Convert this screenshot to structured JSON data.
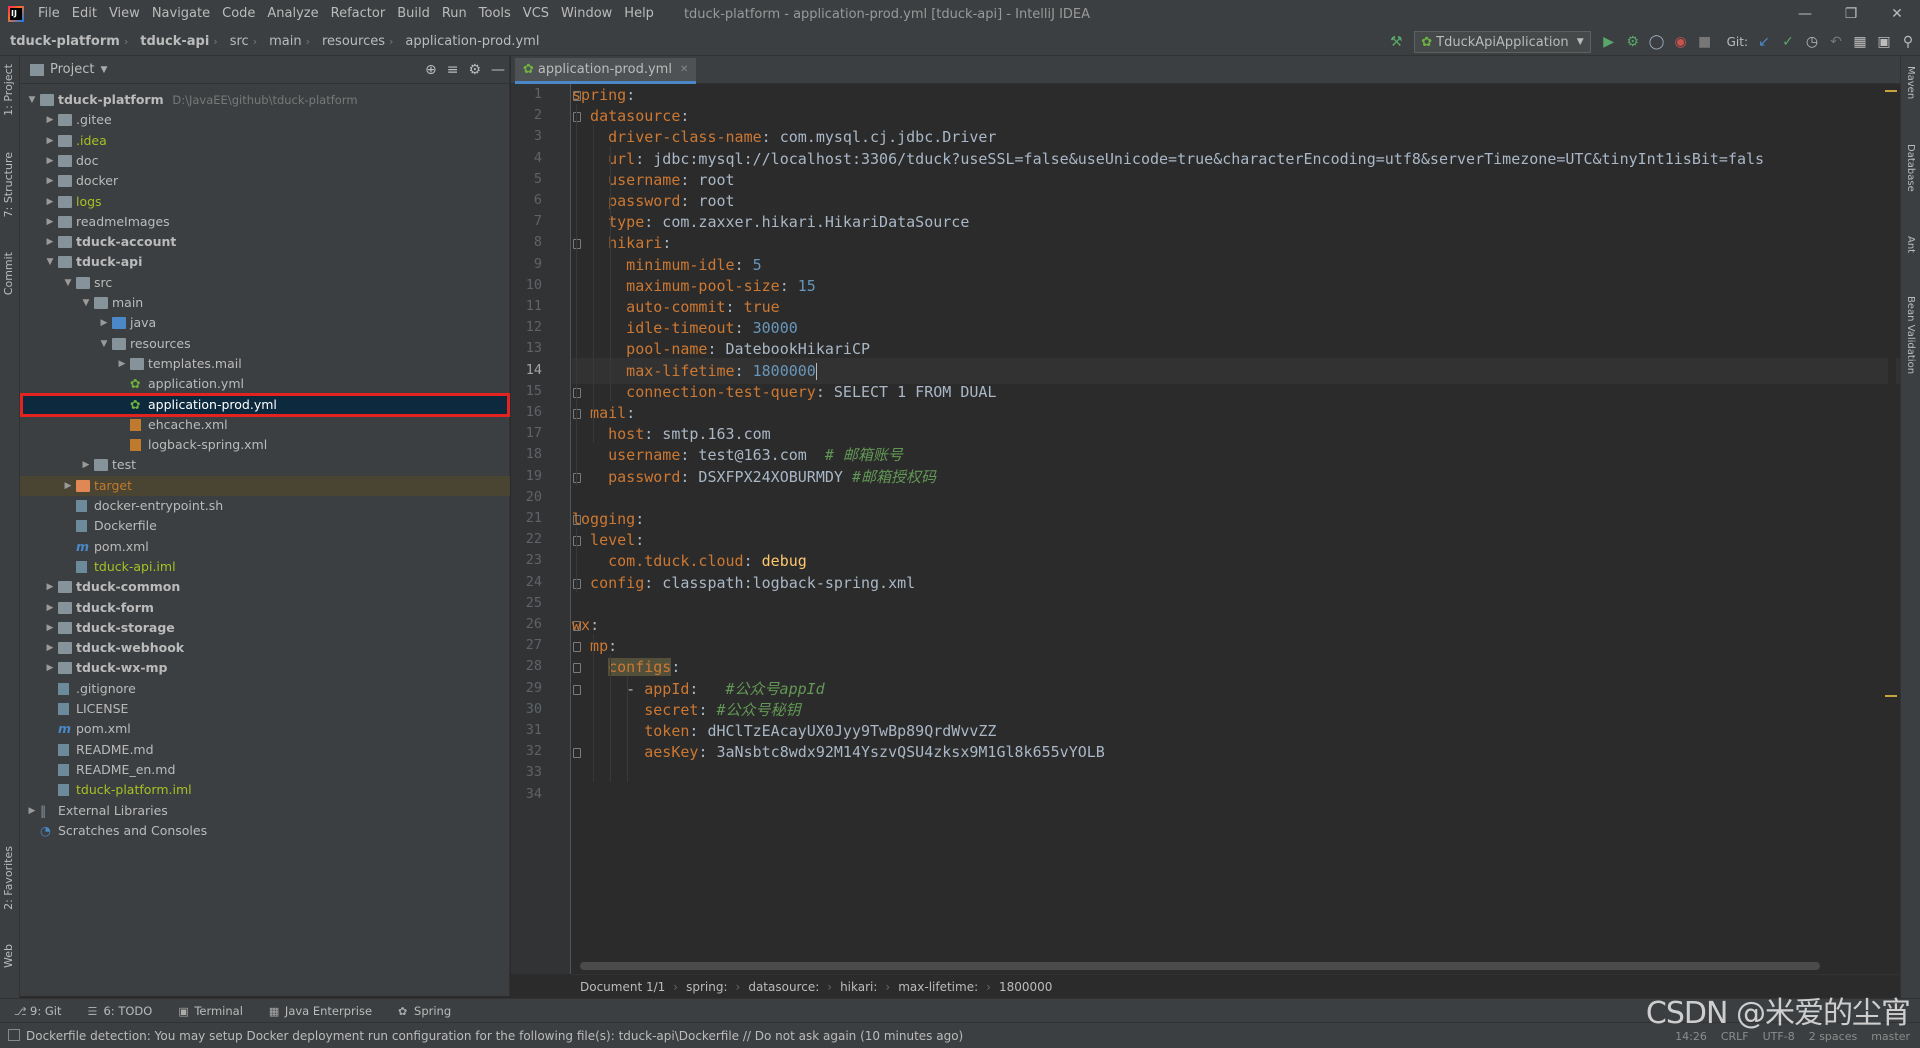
{
  "window": {
    "title": "tduck-platform - application-prod.yml [tduck-api] - IntelliJ IDEA",
    "menu": [
      "File",
      "Edit",
      "View",
      "Navigate",
      "Code",
      "Analyze",
      "Refactor",
      "Build",
      "Run",
      "Tools",
      "VCS",
      "Window",
      "Help"
    ],
    "logo_text": "IJ"
  },
  "navbar": {
    "crumbs": [
      "tduck-platform",
      "tduck-api",
      "src",
      "main",
      "resources",
      "application-prod.yml"
    ],
    "run_config": "TduckApiApplication",
    "git_label": "Git:"
  },
  "left_strip": [
    "1: Project",
    "7: Structure",
    "Commit",
    "2: Favorites",
    "Web"
  ],
  "right_strip": [
    "Maven",
    "Database",
    "Ant",
    "Bean Validation"
  ],
  "project_panel": {
    "title": "Project",
    "tree": [
      {
        "label": "tduck-platform",
        "path": "D:\\JavaEE\\github\\tduck-platform",
        "depth": 0,
        "arrow": "open",
        "icon": "folder",
        "bold": true
      },
      {
        "label": ".gitee",
        "depth": 1,
        "arrow": "closed",
        "icon": "folder"
      },
      {
        "label": ".idea",
        "depth": 1,
        "arrow": "closed",
        "icon": "folder",
        "color": "#a8c023"
      },
      {
        "label": "doc",
        "depth": 1,
        "arrow": "closed",
        "icon": "folder"
      },
      {
        "label": "docker",
        "depth": 1,
        "arrow": "closed",
        "icon": "folder"
      },
      {
        "label": "logs",
        "depth": 1,
        "arrow": "closed",
        "icon": "folder",
        "color": "#a8c023"
      },
      {
        "label": "readmeImages",
        "depth": 1,
        "arrow": "closed",
        "icon": "folder"
      },
      {
        "label": "tduck-account",
        "depth": 1,
        "arrow": "closed",
        "icon": "folder",
        "bold": true
      },
      {
        "label": "tduck-api",
        "depth": 1,
        "arrow": "open",
        "icon": "folder",
        "bold": true
      },
      {
        "label": "src",
        "depth": 2,
        "arrow": "open",
        "icon": "folder"
      },
      {
        "label": "main",
        "depth": 3,
        "arrow": "open",
        "icon": "folder"
      },
      {
        "label": "java",
        "depth": 4,
        "arrow": "closed",
        "icon": "folder-blue"
      },
      {
        "label": "resources",
        "depth": 4,
        "arrow": "open",
        "icon": "folder"
      },
      {
        "label": "templates.mail",
        "depth": 5,
        "arrow": "closed",
        "icon": "folder"
      },
      {
        "label": "application.yml",
        "depth": 5,
        "arrow": "none",
        "icon": "yml"
      },
      {
        "label": "application-prod.yml",
        "depth": 5,
        "arrow": "none",
        "icon": "yml",
        "selected": true
      },
      {
        "label": "ehcache.xml",
        "depth": 5,
        "arrow": "none",
        "icon": "xml"
      },
      {
        "label": "logback-spring.xml",
        "depth": 5,
        "arrow": "none",
        "icon": "xml"
      },
      {
        "label": "test",
        "depth": 3,
        "arrow": "closed",
        "icon": "folder"
      },
      {
        "label": "target",
        "depth": 2,
        "arrow": "closed",
        "icon": "folder-orange",
        "color": "#c07a2e",
        "highlight": true
      },
      {
        "label": "docker-entrypoint.sh",
        "depth": 2,
        "arrow": "none",
        "icon": "file"
      },
      {
        "label": "Dockerfile",
        "depth": 2,
        "arrow": "none",
        "icon": "file"
      },
      {
        "label": "pom.xml",
        "depth": 2,
        "arrow": "none",
        "icon": "maven"
      },
      {
        "label": "tduck-api.iml",
        "depth": 2,
        "arrow": "none",
        "icon": "file",
        "color": "#a8c023"
      },
      {
        "label": "tduck-common",
        "depth": 1,
        "arrow": "closed",
        "icon": "folder",
        "bold": true
      },
      {
        "label": "tduck-form",
        "depth": 1,
        "arrow": "closed",
        "icon": "folder",
        "bold": true
      },
      {
        "label": "tduck-storage",
        "depth": 1,
        "arrow": "closed",
        "icon": "folder",
        "bold": true
      },
      {
        "label": "tduck-webhook",
        "depth": 1,
        "arrow": "closed",
        "icon": "folder",
        "bold": true
      },
      {
        "label": "tduck-wx-mp",
        "depth": 1,
        "arrow": "closed",
        "icon": "folder",
        "bold": true
      },
      {
        "label": ".gitignore",
        "depth": 1,
        "arrow": "none",
        "icon": "file"
      },
      {
        "label": "LICENSE",
        "depth": 1,
        "arrow": "none",
        "icon": "file"
      },
      {
        "label": "pom.xml",
        "depth": 1,
        "arrow": "none",
        "icon": "maven"
      },
      {
        "label": "README.md",
        "depth": 1,
        "arrow": "none",
        "icon": "file"
      },
      {
        "label": "README_en.md",
        "depth": 1,
        "arrow": "none",
        "icon": "file"
      },
      {
        "label": "tduck-platform.iml",
        "depth": 1,
        "arrow": "none",
        "icon": "file",
        "color": "#a8c023"
      },
      {
        "label": "External Libraries",
        "depth": 0,
        "arrow": "closed",
        "icon": "lib"
      },
      {
        "label": "Scratches and Consoles",
        "depth": 0,
        "arrow": "none",
        "icon": "scratch"
      }
    ]
  },
  "editor": {
    "tab": "application-prod.yml",
    "current_line": 14,
    "lines": [
      [
        {
          "t": "spring",
          "c": "k"
        },
        {
          "t": ":",
          "c": "v"
        }
      ],
      [
        {
          "t": "  datasource",
          "c": "k"
        },
        {
          "t": ":",
          "c": "v"
        }
      ],
      [
        {
          "t": "    driver-class-name",
          "c": "k"
        },
        {
          "t": ": com.mysql.cj.jdbc.Driver",
          "c": "v"
        }
      ],
      [
        {
          "t": "    url",
          "c": "k"
        },
        {
          "t": ": jdbc:mysql://localhost:3306/tduck?useSSL=false&useUnicode=true&characterEncoding=utf8&serverTimezone=UTC&tinyInt1isBit=fals",
          "c": "v"
        }
      ],
      [
        {
          "t": "    username",
          "c": "k"
        },
        {
          "t": ": root",
          "c": "v"
        }
      ],
      [
        {
          "t": "    password",
          "c": "k"
        },
        {
          "t": ": root",
          "c": "v"
        }
      ],
      [
        {
          "t": "    type",
          "c": "k"
        },
        {
          "t": ": com.zaxxer.hikari.HikariDataSource",
          "c": "v"
        }
      ],
      [
        {
          "t": "    hikari",
          "c": "k"
        },
        {
          "t": ":",
          "c": "v"
        }
      ],
      [
        {
          "t": "      minimum-idle",
          "c": "k"
        },
        {
          "t": ": ",
          "c": "v"
        },
        {
          "t": "5",
          "c": "n"
        }
      ],
      [
        {
          "t": "      maximum-pool-size",
          "c": "k"
        },
        {
          "t": ": ",
          "c": "v"
        },
        {
          "t": "15",
          "c": "n"
        }
      ],
      [
        {
          "t": "      auto-commit",
          "c": "k"
        },
        {
          "t": ": ",
          "c": "v"
        },
        {
          "t": "true",
          "c": "k"
        }
      ],
      [
        {
          "t": "      idle-timeout",
          "c": "k"
        },
        {
          "t": ": ",
          "c": "v"
        },
        {
          "t": "30000",
          "c": "n"
        }
      ],
      [
        {
          "t": "      pool-name",
          "c": "k"
        },
        {
          "t": ": DatebookHikariCP",
          "c": "v"
        }
      ],
      [
        {
          "t": "      max-lifetime",
          "c": "k"
        },
        {
          "t": ": ",
          "c": "v"
        },
        {
          "t": "1800000",
          "c": "n"
        }
      ],
      [
        {
          "t": "      connection-test-query",
          "c": "k"
        },
        {
          "t": ": SELECT 1 FROM DUAL",
          "c": "v"
        }
      ],
      [
        {
          "t": "  mail",
          "c": "k"
        },
        {
          "t": ":",
          "c": "v"
        }
      ],
      [
        {
          "t": "    host",
          "c": "k"
        },
        {
          "t": ": smtp.163.com",
          "c": "v"
        }
      ],
      [
        {
          "t": "    username",
          "c": "k"
        },
        {
          "t": ": test@163.com  ",
          "c": "v"
        },
        {
          "t": "# 邮箱账号",
          "c": "c"
        }
      ],
      [
        {
          "t": "    password",
          "c": "k"
        },
        {
          "t": ": DSXFPX24XOBURMDY ",
          "c": "v"
        },
        {
          "t": "#邮箱授权码",
          "c": "c"
        }
      ],
      [],
      [
        {
          "t": "logging",
          "c": "k"
        },
        {
          "t": ":",
          "c": "v"
        }
      ],
      [
        {
          "t": "  level",
          "c": "k"
        },
        {
          "t": ":",
          "c": "v"
        }
      ],
      [
        {
          "t": "    com.tduck.cloud",
          "c": "k"
        },
        {
          "t": ": ",
          "c": "v"
        },
        {
          "t": "debug",
          "c": "y"
        }
      ],
      [
        {
          "t": "  config",
          "c": "k"
        },
        {
          "t": ": classpath:logback-spring.xml",
          "c": "v"
        }
      ],
      [],
      [
        {
          "t": "wx",
          "c": "k"
        },
        {
          "t": ":",
          "c": "v"
        }
      ],
      [
        {
          "t": "  mp",
          "c": "k"
        },
        {
          "t": ":",
          "c": "v"
        }
      ],
      [
        {
          "t": "    ",
          "c": "v"
        },
        {
          "t": "configs",
          "c": "khl"
        },
        {
          "t": ":",
          "c": "v"
        }
      ],
      [
        {
          "t": "      - ",
          "c": "v"
        },
        {
          "t": "appId",
          "c": "k"
        },
        {
          "t": ":   ",
          "c": "v"
        },
        {
          "t": "#公众号appId",
          "c": "c"
        }
      ],
      [
        {
          "t": "        secret",
          "c": "k"
        },
        {
          "t": ": ",
          "c": "v"
        },
        {
          "t": "#公众号秘钥",
          "c": "c"
        }
      ],
      [
        {
          "t": "        token",
          "c": "k"
        },
        {
          "t": ": dHClTzEAcayUX0Jyy9TwBp89QrdWvvZZ",
          "c": "v"
        }
      ],
      [
        {
          "t": "        aesKey",
          "c": "k"
        },
        {
          "t": ": 3aNsbtc8wdx92M14YszvQSU4zksx9M1Gl8k655vYOLB",
          "c": "v"
        }
      ],
      [],
      []
    ]
  },
  "editor_breadcrumb": [
    "Document 1/1",
    "spring:",
    "datasource:",
    "hikari:",
    "max-lifetime:",
    "1800000"
  ],
  "bottom_tools": [
    {
      "icon": "git-icon",
      "label": "9: Git"
    },
    {
      "icon": "todo-icon",
      "label": "6: TODO"
    },
    {
      "icon": "terminal-icon",
      "label": "Terminal"
    },
    {
      "icon": "java-enterprise-icon",
      "label": "Java Enterprise"
    },
    {
      "icon": "spring-icon",
      "label": "Spring"
    }
  ],
  "status": {
    "message": "Dockerfile detection: You may setup Docker deployment run configuration for the following file(s): tduck-api\\Dockerfile // Do not ask again (10 minutes ago)",
    "position": "14:26",
    "line_sep": "CRLF",
    "encoding": "UTF-8",
    "indent": "2 spaces",
    "branch": "master"
  },
  "watermark": "CSDN @米爱的尘宵"
}
